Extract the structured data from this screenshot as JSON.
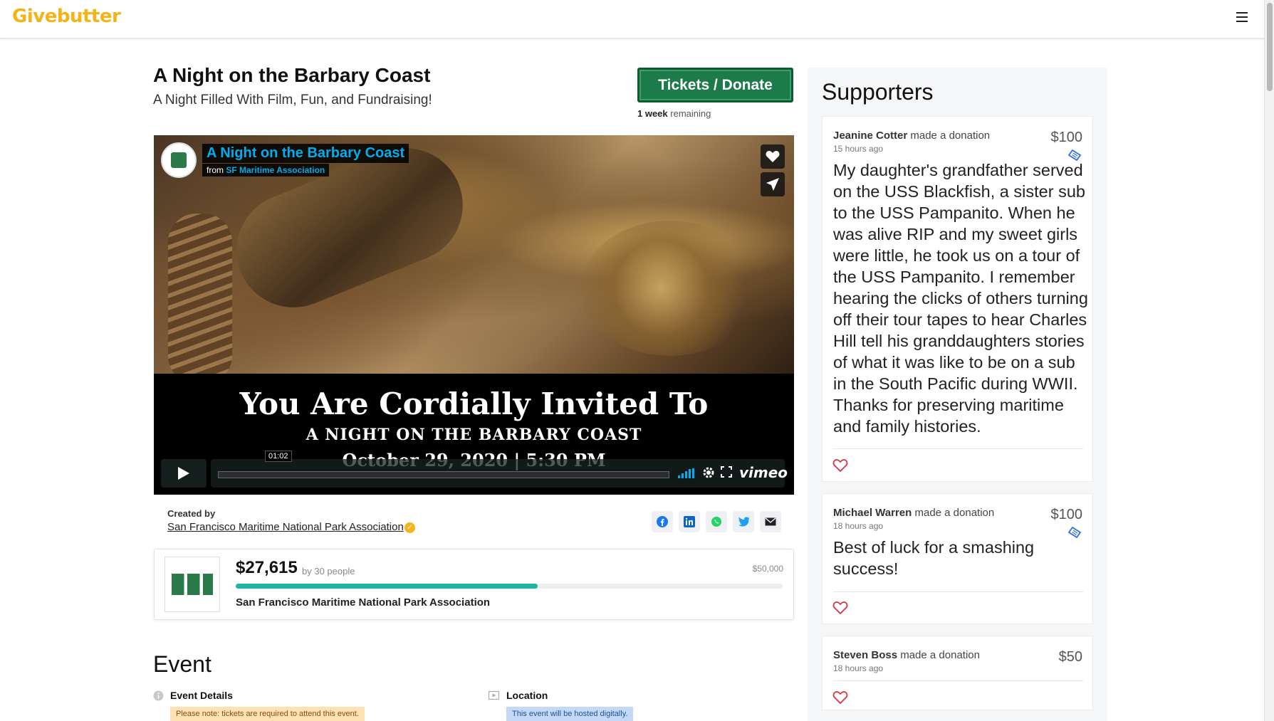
{
  "nav": {
    "logo": "Givebutter"
  },
  "campaign": {
    "title": "A Night on the Barbary Coast",
    "subtitle": "A Night Filled With Film, Fun, and Fundraising!",
    "cta_label": "Tickets / Donate",
    "remaining_bold": "1 week",
    "remaining_rest": " remaining"
  },
  "video": {
    "title": "A Night on the Barbary Coast",
    "from_label": "from ",
    "from_name": "SF Maritime Association",
    "headline": "You Are Cordially Invited To",
    "subheadline": "A NIGHT ON THE BARBARY COAST",
    "dateline": "October 29, 2020 | 5:30 PM",
    "timestamp": "01:02",
    "brand": "vimeo"
  },
  "creator": {
    "label": "Created by",
    "name": "San Francisco Maritime National Park Association",
    "share_icons": [
      "facebook-icon",
      "linkedin-icon",
      "whatsapp-icon",
      "twitter-icon",
      "email-icon"
    ]
  },
  "progress": {
    "raised": "$27,615",
    "by": "by 30 people",
    "goal": "$50,000",
    "fraction": 0.552,
    "org": "San Francisco Maritime National Park Association"
  },
  "event": {
    "heading": "Event",
    "details_label": "Event Details",
    "details_note": "Please note: tickets are required to attend this event.",
    "location_label": "Location",
    "location_note": "This event will be hosted digitally."
  },
  "supporters": {
    "heading": "Supporters",
    "action": "made a donation",
    "items": [
      {
        "name": "Jeanine Cotter",
        "time": "15 hours ago",
        "amount": "$100",
        "message": "My daughter's grandfather served on the USS Blackfish, a sister sub to the USS Pampanito. When he was alive RIP and my sweet girls were little, he took us on a tour of the USS Pampanito. I remember hearing the clicks of others turning off their tour tapes to hear Charles Hill tell his granddaughters stories of what it was like to be on a sub in the South Pacific during WWII. Thanks for preserving maritime and family histories."
      },
      {
        "name": "Michael Warren",
        "time": "18 hours ago",
        "amount": "$100",
        "message": "Best of luck for a smashing success!"
      },
      {
        "name": "Steven Boss",
        "time": "18 hours ago",
        "amount": "$50",
        "message": ""
      }
    ]
  },
  "colors": {
    "brand_yellow": "#f2b417",
    "cta_green": "#1d7a4a",
    "progress_teal": "#1fb5a0",
    "vimeo_blue": "#00adef",
    "heart_red": "#e0313f"
  }
}
